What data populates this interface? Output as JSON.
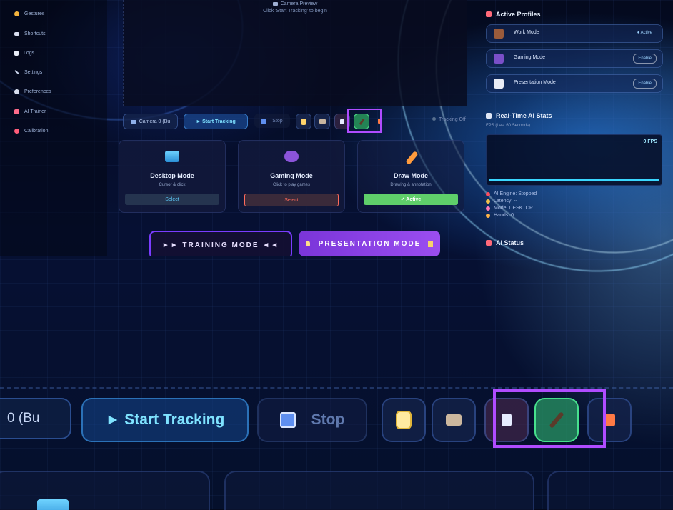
{
  "sidebar": {
    "items": [
      {
        "label": "Gestures",
        "icon": "hand-icon",
        "color": "#f2b33d"
      },
      {
        "label": "Shortcuts",
        "icon": "keyboard-icon",
        "color": "#d9def0"
      },
      {
        "label": "Logs",
        "icon": "document-icon",
        "color": "#e9edf8"
      },
      {
        "label": "Settings",
        "icon": "wrench-icon",
        "color": "#c9d3ea"
      },
      {
        "label": "Preferences",
        "icon": "gear-icon",
        "color": "#d8dfee"
      },
      {
        "label": "AI Trainer",
        "icon": "robot-icon",
        "color": "#ff6b8a"
      },
      {
        "label": "Calibration",
        "icon": "target-icon",
        "color": "#ff5d7a"
      }
    ]
  },
  "preview": {
    "title": "Camera Preview",
    "subtitle": "Click 'Start Tracking' to begin"
  },
  "toolbar": {
    "camera_select": "Camera 0 (Bu",
    "camera_select_zoom": "0 (Bu",
    "start_label": "► Start Tracking",
    "stop_label": "Stop",
    "status": "Tracking Off"
  },
  "modes": [
    {
      "title": "Desktop Mode",
      "desc": "Cursor & click",
      "button": "Select",
      "state": "select"
    },
    {
      "title": "Gaming Mode",
      "desc": "Click to play games",
      "button": "Select",
      "state": "select-red"
    },
    {
      "title": "Draw Mode",
      "desc": "Drawing & annotation",
      "button": "✓ Active",
      "state": "active"
    }
  ],
  "bottom_buttons": {
    "training": "►► TRAINING MODE ◄◄",
    "presentation": "PRESENTATION MODE"
  },
  "profiles": {
    "heading": "Active Profiles",
    "items": [
      {
        "name": "Work Mode",
        "status": "● Active"
      },
      {
        "name": "Gaming Mode",
        "status": "Enable"
      },
      {
        "name": "Presentation Mode",
        "status": "Enable"
      }
    ]
  },
  "stats": {
    "heading": "Real-Time AI Stats",
    "subheading": "FPS (Last 60 Seconds)",
    "fps": "0 FPS",
    "rows": [
      {
        "label": "AI Engine: Stopped",
        "color": "#ff4d5e"
      },
      {
        "label": "Latency: --",
        "color": "#f3c24a"
      },
      {
        "label": "Mode: DESKTOP",
        "color": "#ff7ab8"
      },
      {
        "label": "Hands: 0",
        "color": "#ffb347"
      }
    ]
  },
  "status_heading": "AI Status",
  "colors": {
    "accent_purple": "#b04cff",
    "accent_cyan": "#7fe3ff",
    "active_green": "#47e08d"
  }
}
